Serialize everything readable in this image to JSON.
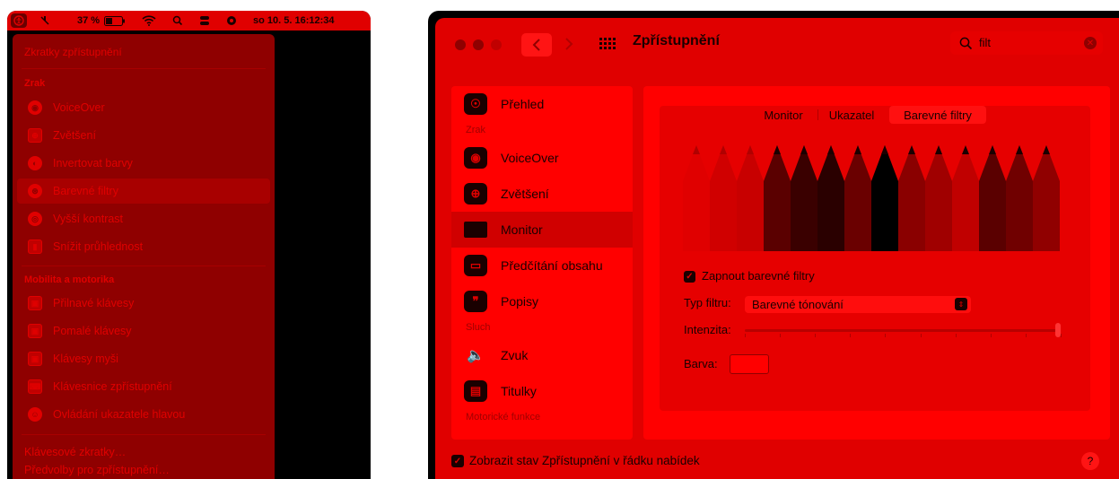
{
  "menubar": {
    "battery_percent": "37 %",
    "datetime": "so 10. 5.  16:12:34"
  },
  "dropdown": {
    "title": "Zkratky zpřístupnění",
    "section_vision": "Zrak",
    "vision_items": [
      "VoiceOver",
      "Zvětšení",
      "Invertovat barvy",
      "Barevné filtry",
      "Vyšší kontrast",
      "Snížit průhlednost"
    ],
    "section_mobility": "Mobilita a motorika",
    "mobility_items": [
      "Přilnavé klávesy",
      "Pomalé klávesy",
      "Klávesy myši",
      "Klávesnice zpřístupnění",
      "Ovládání ukazatele hlavou"
    ],
    "footer_items": [
      "Klávesové zkratky…",
      "Předvolby pro zpřístupnění…"
    ]
  },
  "window": {
    "title": "Zpřístupnění",
    "search_value": "filt",
    "help": "?",
    "footer_checkbox_label": "Zobrazit stav Zpřístupnění v řádku nabídek"
  },
  "sidebar": {
    "items": {
      "overview": "Přehled",
      "section_vision": "Zrak",
      "voiceover": "VoiceOver",
      "zoom": "Zvětšení",
      "display": "Monitor",
      "spoken_content": "Předčítání obsahu",
      "descriptions": "Popisy",
      "section_hearing": "Sluch",
      "audio": "Zvuk",
      "captions": "Titulky",
      "section_motor": "Motorické funkce"
    }
  },
  "content": {
    "tabs": [
      "Monitor",
      "Ukazatel",
      "Barevné filtry"
    ],
    "enable_label": "Zapnout barevné filtry",
    "filter_type_label": "Typ filtru:",
    "filter_type_value": "Barevné tónování",
    "intensity_label": "Intenzita:",
    "intensity_value": 1.0,
    "color_label": "Barva:"
  },
  "colors": {
    "accent": "#e00000",
    "dark": "#1a0000",
    "menu_bg": "#8f0000"
  }
}
